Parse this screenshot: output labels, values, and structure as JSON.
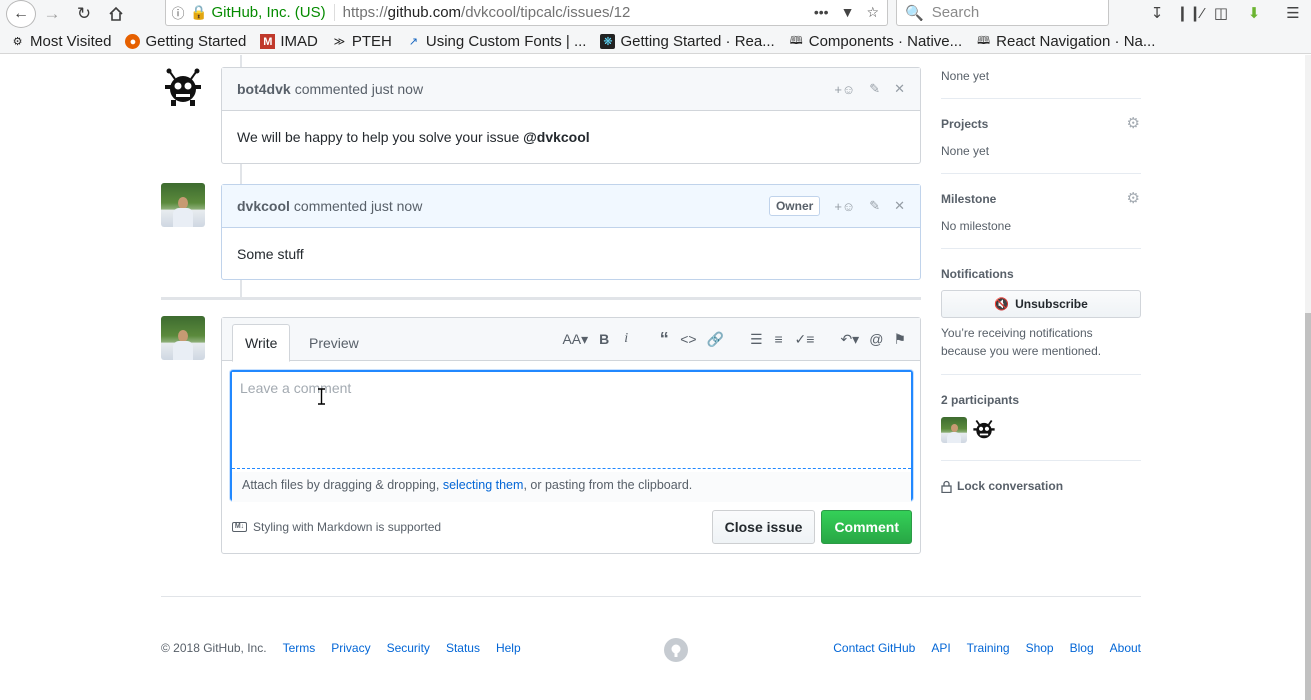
{
  "browser": {
    "identity": "GitHub, Inc. (US)",
    "url_prefix": "https://",
    "url_host": "github.com",
    "url_path": "/dvkcool/tipcalc/issues/12",
    "search_placeholder": "Search",
    "icons": {
      "back": "back-arrow-icon",
      "forward": "forward-arrow-icon",
      "reload": "reload-icon",
      "home": "home-icon",
      "menu": "hamburger-menu-icon"
    }
  },
  "bookmarks": [
    {
      "label": "Most Visited",
      "icon": "gear-icon"
    },
    {
      "label": "Getting Started",
      "icon": "firefox-icon"
    },
    {
      "label": "IMAD",
      "icon": "imad-icon"
    },
    {
      "label": "PTEH",
      "icon": "pteh-icon"
    },
    {
      "label": "Using Custom Fonts | ...",
      "icon": "rn-icon"
    },
    {
      "label": "Getting Started · Rea...",
      "icon": "react-icon"
    },
    {
      "label": "Components · Native...",
      "icon": "bookmark-folder-icon"
    },
    {
      "label": "React Navigation · Na...",
      "icon": "bookmark-folder-icon"
    }
  ],
  "timeline": {
    "comments": [
      {
        "author": "bot4dvk",
        "meta": "commented just now",
        "body_text": "We will be happy to help you solve your issue ",
        "body_mention": "@dvkcool"
      },
      {
        "author": "dvkcool",
        "meta": "commented just now",
        "badge": "Owner",
        "body_text": "Some stuff"
      }
    ]
  },
  "new_comment": {
    "tabs": [
      "Write",
      "Preview"
    ],
    "placeholder": "Leave a comment",
    "attach_prefix": "Attach files by dragging & dropping, ",
    "attach_link": "selecting them",
    "attach_suffix": ", or pasting from the clipboard.",
    "markdown_note": "Styling with Markdown is supported",
    "close_label": "Close issue",
    "comment_label": "Comment",
    "toolbar": {
      "header": "AA",
      "bold": "B",
      "italic": "i"
    }
  },
  "sidebar": {
    "labels_value": "None yet",
    "projects_title": "Projects",
    "projects_value": "None yet",
    "milestone_title": "Milestone",
    "milestone_value": "No milestone",
    "notifications_title": "Notifications",
    "unsubscribe_label": "Unsubscribe",
    "notif_reason": "You’re receiving notifications because you were mentioned.",
    "participants_title": "2 participants",
    "lock_label": "Lock conversation"
  },
  "footer": {
    "copyright": "© 2018 GitHub, Inc.",
    "left_links": [
      "Terms",
      "Privacy",
      "Security",
      "Status",
      "Help"
    ],
    "right_links": [
      "Contact GitHub",
      "API",
      "Training",
      "Shop",
      "Blog",
      "About"
    ]
  }
}
